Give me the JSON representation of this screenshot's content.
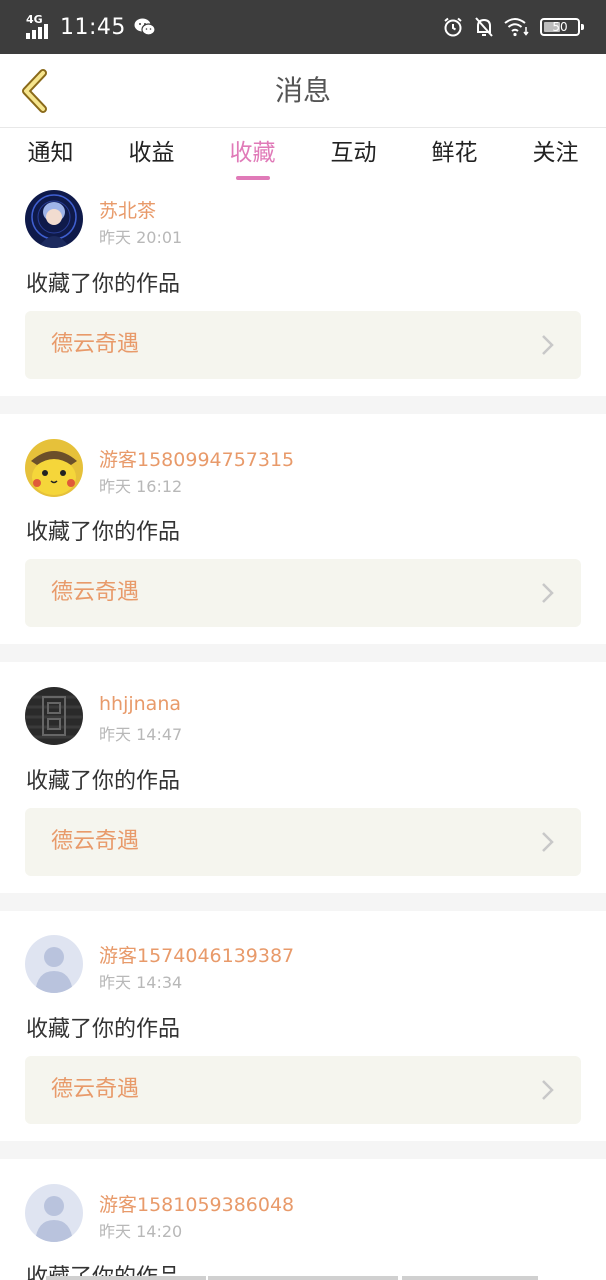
{
  "status_bar": {
    "network": "4G",
    "time": "11:45",
    "battery": "50",
    "battery_level": 0.5,
    "icons": [
      "signal-icon",
      "wechat-icon",
      "alarm-icon",
      "bell-muted-icon",
      "wifi-icon",
      "battery-icon"
    ]
  },
  "header": {
    "title": "消息",
    "back_icon": "chevron-left-icon"
  },
  "tabs": [
    {
      "label": "通知",
      "active": false
    },
    {
      "label": "收益",
      "active": false
    },
    {
      "label": "收藏",
      "active": true
    },
    {
      "label": "互动",
      "active": false
    },
    {
      "label": "鲜花",
      "active": false
    },
    {
      "label": "关注",
      "active": false
    }
  ],
  "colors": {
    "accent": "#e07ab8",
    "name": "#e89a6a",
    "status_bar": "#3d3d3d"
  },
  "messages": [
    {
      "user": "苏北茶",
      "time": "昨天 20:01",
      "action": "收藏了你的作品",
      "work": "德云奇遇",
      "avatar": "anime-avatar"
    },
    {
      "user": "游客1580994757315",
      "time": "昨天 16:12",
      "action": "收藏了你的作品",
      "work": "德云奇遇",
      "avatar": "pikachu-avatar"
    },
    {
      "user": "hhjjnana",
      "time": "昨天 14:47",
      "action": "收藏了你的作品",
      "work": "德云奇遇",
      "avatar": "dark-pattern-avatar"
    },
    {
      "user": "游客1574046139387",
      "time": "昨天 14:34",
      "action": "收藏了你的作品",
      "work": "德云奇遇",
      "avatar": "default-avatar"
    },
    {
      "user": "游客1581059386048",
      "time": "昨天 14:20",
      "action": "收藏了你的作品",
      "work": "",
      "avatar": "default-avatar"
    }
  ]
}
